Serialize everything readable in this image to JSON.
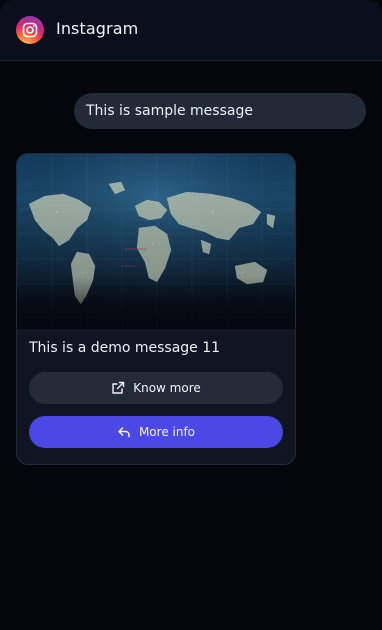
{
  "header": {
    "app_name": "Instagram",
    "logo_icon": "instagram-logo-icon"
  },
  "messages": {
    "outgoing_text": "This is sample message",
    "card": {
      "image_subject": "world-map",
      "text": "This is a demo message 11",
      "primary_button": {
        "label": "Know more",
        "icon": "external-link-icon"
      },
      "secondary_button": {
        "label": "More info",
        "icon": "reply-icon"
      }
    }
  },
  "colors": {
    "background": "#04060c",
    "header": "#0a0f1b",
    "bubble": "#222a37",
    "card": "#101521",
    "button_dark": "#232b38",
    "button_accent": "#4a49e6"
  }
}
